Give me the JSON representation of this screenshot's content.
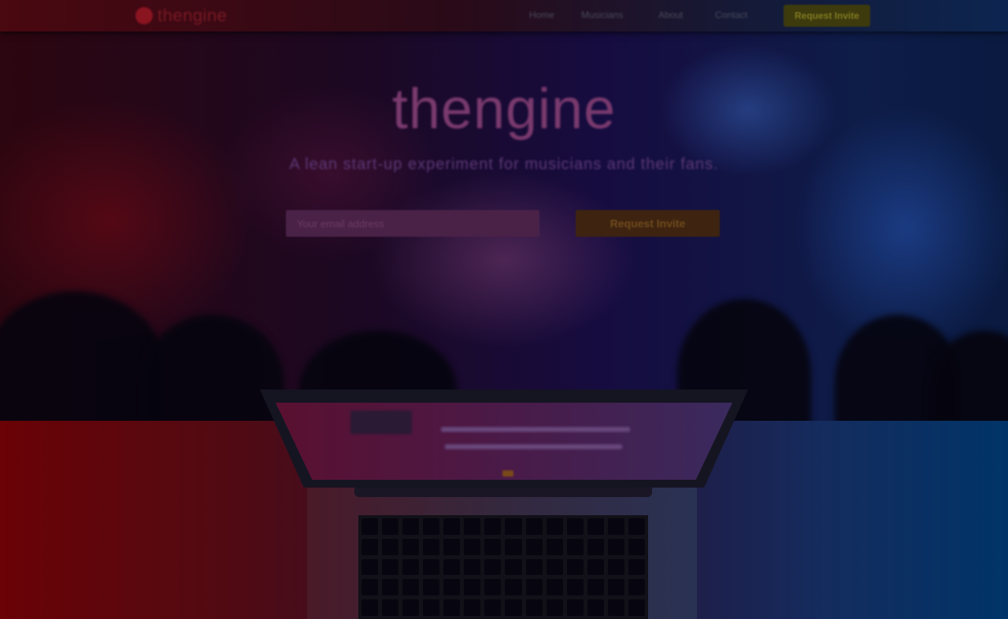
{
  "nav": {
    "logo_text": "thengine",
    "links": [
      "Home",
      "Musicians",
      "About",
      "Contact"
    ],
    "cta_label": "Request Invite"
  },
  "hero": {
    "title": "thengine",
    "subtitle": "A lean start-up experiment for musicians and their fans.",
    "email_placeholder": "Your email address",
    "cta_label": "Request Invite"
  },
  "colors": {
    "nav_cta": "#3d3a0e",
    "hero_cta": "#3e2410",
    "bottom_left": "#6a0206",
    "bottom_right": "#003468"
  },
  "icons": [
    "logo-icon",
    "laptop-illustration"
  ]
}
